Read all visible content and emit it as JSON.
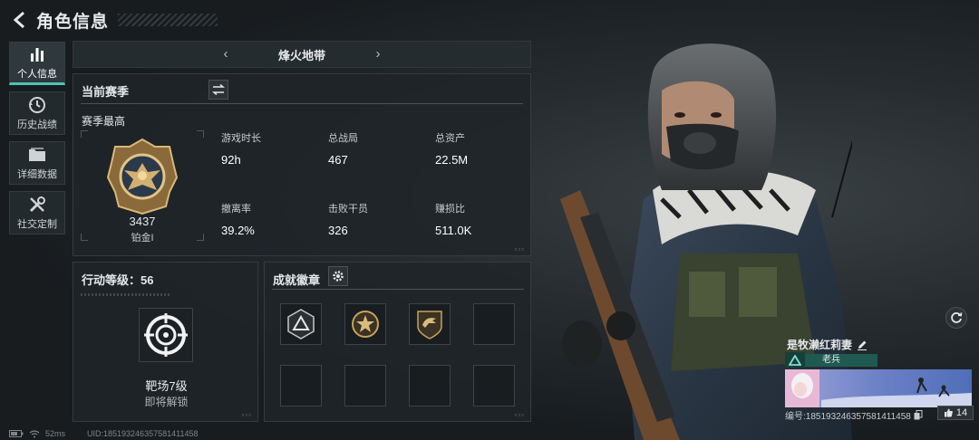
{
  "header": {
    "title": "角色信息",
    "back_icon": "chevron-left-icon"
  },
  "nav": {
    "items": [
      {
        "label": "个人信息",
        "icon": "bar-chart-icon",
        "active": true
      },
      {
        "label": "历史战绩",
        "icon": "history-icon",
        "active": false
      },
      {
        "label": "详细数据",
        "icon": "folder-icon",
        "active": false
      },
      {
        "label": "社交定制",
        "icon": "tools-icon",
        "active": false
      }
    ]
  },
  "mode": {
    "title": "烽火地带",
    "prev": "‹",
    "next": "›"
  },
  "season": {
    "title": "当前赛季",
    "best_label": "赛季最高",
    "rank_score": "3437",
    "rank_name": "铂金I",
    "stats": [
      {
        "label": "游戏时长",
        "value": "92h"
      },
      {
        "label": "总战局",
        "value": "467"
      },
      {
        "label": "总资产",
        "value": "22.5M"
      },
      {
        "label": "撤离率",
        "value": "39.2%"
      },
      {
        "label": "击败干员",
        "value": "326"
      },
      {
        "label": "赚损比",
        "value": "511.0K"
      }
    ]
  },
  "action_level": {
    "title": "行动等级：56",
    "unlock_name": "靶场7级",
    "unlock_status": "即将解锁"
  },
  "badges": {
    "title": "成就徽章",
    "slots": [
      "triangle-badge",
      "star-medal-badge",
      "eagle-badge",
      "",
      "",
      "",
      "",
      ""
    ]
  },
  "player": {
    "name": "是牧濑红莉妻",
    "rank_title": "老兵",
    "id_text": "编号:1851932463575814114​58",
    "likes": "14"
  },
  "status": {
    "ping": "52ms",
    "uid": "UID:1851932463575814114​58"
  },
  "colors": {
    "accent": "#4cc3b4",
    "gold": "#c9a15a",
    "panel": "#1e2428"
  }
}
